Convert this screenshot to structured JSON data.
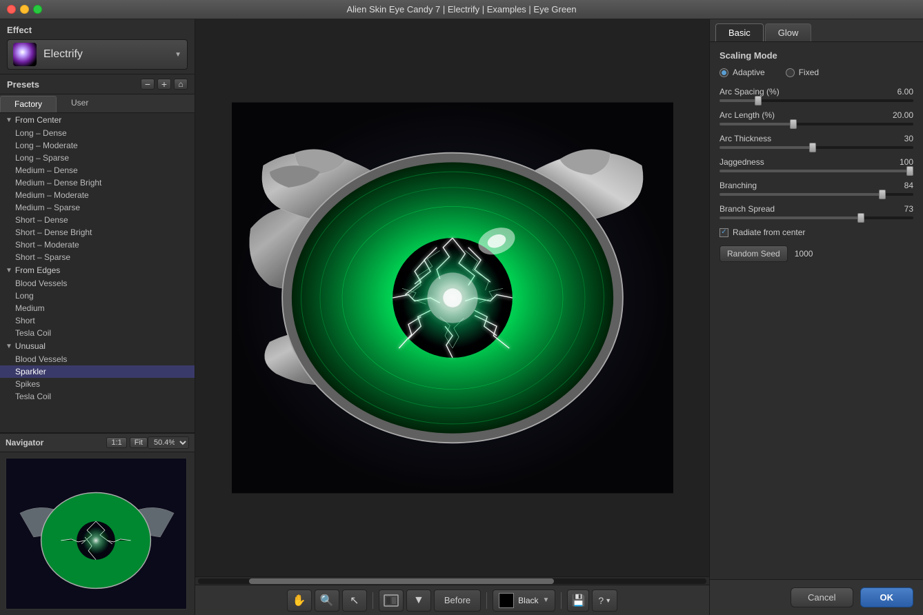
{
  "titlebar": {
    "title": "Alien Skin Eye Candy 7 | Electrify | Examples | Eye Green"
  },
  "left_panel": {
    "effect_label": "Effect",
    "effect_name": "Electrify",
    "presets_label": "Presets",
    "tabs": [
      {
        "id": "factory",
        "label": "Factory",
        "active": true
      },
      {
        "id": "user",
        "label": "User",
        "active": false
      }
    ],
    "preset_groups": [
      {
        "name": "From Center",
        "expanded": true,
        "items": [
          "Long – Dense",
          "Long – Moderate",
          "Long – Sparse",
          "Medium – Dense",
          "Medium – Dense Bright",
          "Medium – Moderate",
          "Medium – Sparse",
          "Short – Dense",
          "Short – Dense Bright",
          "Short – Moderate",
          "Short – Sparse"
        ]
      },
      {
        "name": "From Edges",
        "expanded": true,
        "items": [
          "Blood Vessels",
          "Long",
          "Medium",
          "Short",
          "Tesla Coil"
        ]
      },
      {
        "name": "Unusual",
        "expanded": true,
        "items": [
          "Blood Vessels",
          "Sparkler",
          "Spikes",
          "Tesla Coil"
        ]
      }
    ],
    "selected_item": "Sparkler"
  },
  "navigator": {
    "label": "Navigator",
    "zoom_1_1": "1:1",
    "zoom_fit": "Fit",
    "zoom_value": "50.4%"
  },
  "toolbar": {
    "before_label": "Before",
    "color_label": "Black",
    "save_icon": "💾",
    "help_label": "?"
  },
  "right_panel": {
    "tabs": [
      {
        "label": "Basic",
        "active": true
      },
      {
        "label": "Glow",
        "active": false
      }
    ],
    "scaling_mode_label": "Scaling Mode",
    "scaling_options": [
      {
        "label": "Adaptive",
        "value": "adaptive",
        "checked": true
      },
      {
        "label": "Fixed",
        "value": "fixed",
        "checked": false
      }
    ],
    "sliders": [
      {
        "label": "Arc Spacing (%)",
        "value": 6.0,
        "display": "6.00",
        "percent": 20
      },
      {
        "label": "Arc Length (%)",
        "value": 20.0,
        "display": "20.00",
        "percent": 38
      },
      {
        "label": "Arc Thickness",
        "value": 30,
        "display": "30",
        "percent": 48
      },
      {
        "label": "Jaggedness",
        "value": 100,
        "display": "100",
        "percent": 100
      },
      {
        "label": "Branching",
        "value": 84,
        "display": "84",
        "percent": 84
      },
      {
        "label": "Branch Spread",
        "value": 73,
        "display": "73",
        "percent": 73
      }
    ],
    "radiate_from_center": true,
    "radiate_label": "Radiate from center",
    "random_seed_label": "Random Seed",
    "random_seed_btn": "Random Seed",
    "seed_value": "1000",
    "cancel_label": "Cancel",
    "ok_label": "OK"
  }
}
